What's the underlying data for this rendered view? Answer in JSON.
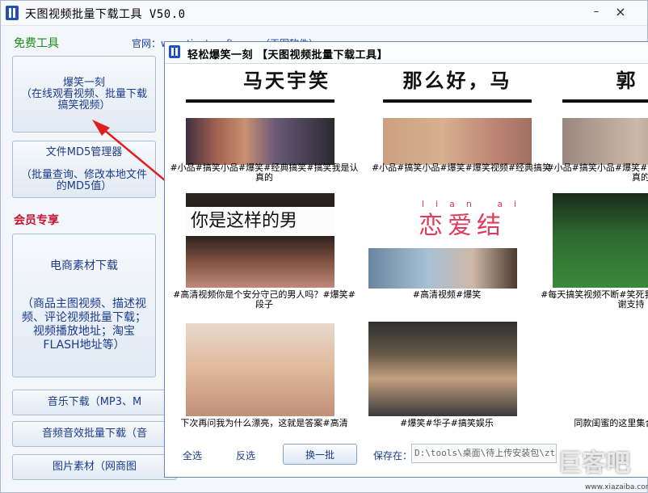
{
  "window": {
    "title": "天图视频批量下载工具 V50.0",
    "minimize": "–",
    "close": "×"
  },
  "sections": {
    "free": "免费工具",
    "vip": "会员专享",
    "official": "官网：www.tiantusoft.com （天图软件）"
  },
  "tools": {
    "baoxiao": {
      "title": "爆笑一刻",
      "desc": "（在线观看视频、批量下载搞笑视频）"
    },
    "md5": {
      "title": "文件MD5管理器",
      "desc": "（批量查询、修改本地文件的MD5值）"
    },
    "ecommerce": {
      "title": "电商素材下载",
      "desc": "（商品主图视频、描述视频、评论视频批量下载；视频播放地址；淘宝FLASH地址等）"
    },
    "music": "音乐下载（MP3、M",
    "audio": "音频音效批量下载（音",
    "images": "图片素材（网商图"
  },
  "child_window": {
    "title": "轻松爆笑一刻 【天图视频批量下载工具】",
    "videos": [
      {
        "top_text": "马天宇笑",
        "caption": "#小品#搞笑小品#爆笑#经典搞笑#搞笑我是认真的"
      },
      {
        "top_text": "那么好，马",
        "caption": "#小品#搞笑小品#爆笑#爆笑视频#经典搞笑"
      },
      {
        "top_text": "郭",
        "caption": "#小品#搞笑小品#爆笑#经典搞笑#搞笑我是认真的"
      },
      {
        "overlay": "你是这样的男",
        "caption": "#高清视频你是个安分守己的男人吗？#爆笑#段子"
      },
      {
        "pinyin": "lian ai jie",
        "overlay": "恋爱结",
        "caption": "#高清视频#爆笑"
      },
      {
        "caption": "#每天搞笑视频不断#笑死我了#爆笑#关注感谢支持"
      },
      {
        "caption": "下次再问我为什么漂亮，这就是答案#高清"
      },
      {
        "caption": "#爆笑#华子#搞笑娱乐"
      },
      {
        "caption": "同款闺蜜的这里集合啦#沙雕"
      }
    ],
    "bottom": {
      "select_all": "全选",
      "invert": "反选",
      "next_batch": "换一批",
      "save_label": "保存在：",
      "save_path": "D:\\tools\\桌面\\待上传安装包\\zt"
    }
  },
  "watermark": {
    "text": "巨客吧",
    "url": "www.xiazaiba.com"
  }
}
